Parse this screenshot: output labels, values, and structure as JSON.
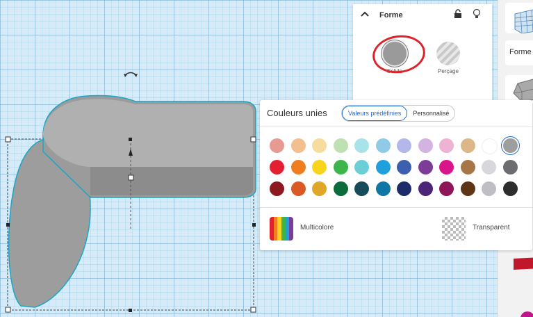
{
  "shape_panel": {
    "title": "Forme",
    "options": [
      {
        "label": "Solide",
        "selected": true
      },
      {
        "label": "Perçage",
        "selected": false
      }
    ],
    "icons": [
      "chevron-up-icon",
      "lock-icon",
      "lightbulb-icon"
    ]
  },
  "color_panel": {
    "title": "Couleurs unies",
    "tabs": [
      {
        "label": "Valeurs prédéfinies",
        "active": true
      },
      {
        "label": "Personnalisé",
        "active": false
      }
    ],
    "swatch_rows": [
      [
        "#e79a91",
        "#f3bf8e",
        "#f6dd9e",
        "#bfe0b3",
        "#a8e3ea",
        "#8fcbe6",
        "#b3b7ea",
        "#d2b3e2",
        "#eeb3d4",
        "#ddb78a",
        "#ffffff",
        "#9e9e9e"
      ],
      [
        "#e32031",
        "#f07d1f",
        "#f8d51c",
        "#3db54a",
        "#6ccfd6",
        "#1ea0dd",
        "#3c5fb0",
        "#7c3d99",
        "#d8158a",
        "#a67646",
        "#d6d8db",
        "#6c6d70"
      ],
      [
        "#8a1a1f",
        "#db5a24",
        "#e0a726",
        "#0c6b3a",
        "#174b5c",
        "#0f76a5",
        "#1c2c6a",
        "#4b2677",
        "#8d1558",
        "#5d3516",
        "#bdbfc2",
        "#2c2d2f"
      ]
    ],
    "selected_color": "#9e9e9e",
    "multicolor_label": "Multicolore",
    "transparent_label": "Transparent"
  },
  "sidebar": {
    "label": "Forme"
  },
  "colors": {
    "accent": "#1a6fd6",
    "highlight_circle": "#e0222b",
    "shape_gray": "#9a9a9a"
  }
}
